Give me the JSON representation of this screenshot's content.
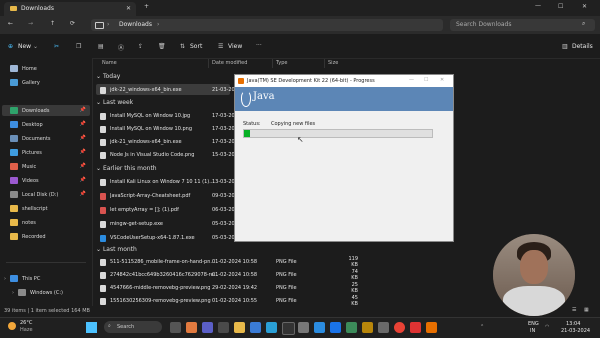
{
  "window": {
    "tab_title": "Downloads"
  },
  "address": {
    "crumb": "Downloads",
    "search_placeholder": "Search Downloads"
  },
  "toolbar": {
    "new": "New",
    "sort": "Sort",
    "view": "View",
    "details": "Details"
  },
  "columns": {
    "name": "Name",
    "date": "Date modified",
    "type": "Type",
    "size": "Size"
  },
  "sidebar": {
    "items": [
      {
        "label": "Home"
      },
      {
        "label": "Gallery"
      },
      {
        "label": "Downloads"
      },
      {
        "label": "Desktop"
      },
      {
        "label": "Documents"
      },
      {
        "label": "Pictures"
      },
      {
        "label": "Music"
      },
      {
        "label": "Videos"
      },
      {
        "label": "Local Disk (D:)"
      },
      {
        "label": "shellscript"
      },
      {
        "label": "notes"
      },
      {
        "label": "Recorded"
      },
      {
        "label": "This PC"
      },
      {
        "label": "Windows (C:)"
      }
    ]
  },
  "groups": {
    "today": "Today",
    "last_week": "Last week",
    "earlier": "Earlier this month",
    "last_month": "Last month"
  },
  "files": {
    "today": [
      {
        "name": "jdk-22_windows-x64_bin.exe",
        "date": "21-03-2024",
        "type": "",
        "size": ""
      }
    ],
    "last_week": [
      {
        "name": "Install MySQL on Window 10.jpg",
        "date": "17-03-2024",
        "type": "",
        "size": ""
      },
      {
        "name": "Install MySQL on Window 10.png",
        "date": "17-03-2024",
        "type": "",
        "size": ""
      },
      {
        "name": "jdk-21_windows-x64_bin.exe",
        "date": "17-03-2024",
        "type": "",
        "size": ""
      },
      {
        "name": "Node Js in Visual Studio Code.png",
        "date": "15-03-2024",
        "type": "",
        "size": ""
      }
    ],
    "earlier": [
      {
        "name": "Install Kali Linux on Window 7 10 11 (1)...",
        "date": "13-03-2024",
        "type": "",
        "size": ""
      },
      {
        "name": "JavaScript-Array-Cheatsheet.pdf",
        "date": "09-03-2024",
        "type": "",
        "size": ""
      },
      {
        "name": "let emptyArray = []; (1).pdf",
        "date": "06-03-2024",
        "type": "",
        "size": ""
      },
      {
        "name": "mingw-get-setup.exe",
        "date": "05-03-2024",
        "type": "",
        "size": ""
      },
      {
        "name": "VSCodeUserSetup-x64-1.87.1.exe",
        "date": "05-03-2024",
        "type": "",
        "size": ""
      }
    ],
    "last_month": [
      {
        "name": "511-5115286_mobile-frame-on-hand-pn...",
        "date": "01-02-2024 10:58",
        "type": "PNG File",
        "size": "119 KB"
      },
      {
        "name": "274842c41bcc649b3260416c7629078-re...",
        "date": "01-02-2024 10:58",
        "type": "PNG File",
        "size": "74 KB"
      },
      {
        "name": "4547666-middle-removebg-preview.png",
        "date": "29-02-2024 19:42",
        "type": "PNG File",
        "size": "25 KB"
      },
      {
        "name": "1551630256309-removebg-preview.png",
        "date": "01-02-2024 10:55",
        "type": "PNG File",
        "size": "45 KB"
      }
    ]
  },
  "statusbar": {
    "text": "39 items  |  1 item selected  164 MB"
  },
  "dialog": {
    "title": "Java(TM) SE Development Kit 22 (64-bit) - Progress",
    "logo": "Java",
    "status_label": "Status:",
    "status_value": "Copying new files",
    "progress_fraction": 0.03
  },
  "taskbar": {
    "weather_temp": "26°C",
    "weather_desc": "Haze",
    "search": "Search",
    "lang1": "ENG",
    "lang2": "IN",
    "time": "13:04",
    "date": "21-03-2024"
  },
  "colors": {
    "accent": "#4cc2ff",
    "progress": "#06b025",
    "java_banner": "#5c86b6"
  }
}
